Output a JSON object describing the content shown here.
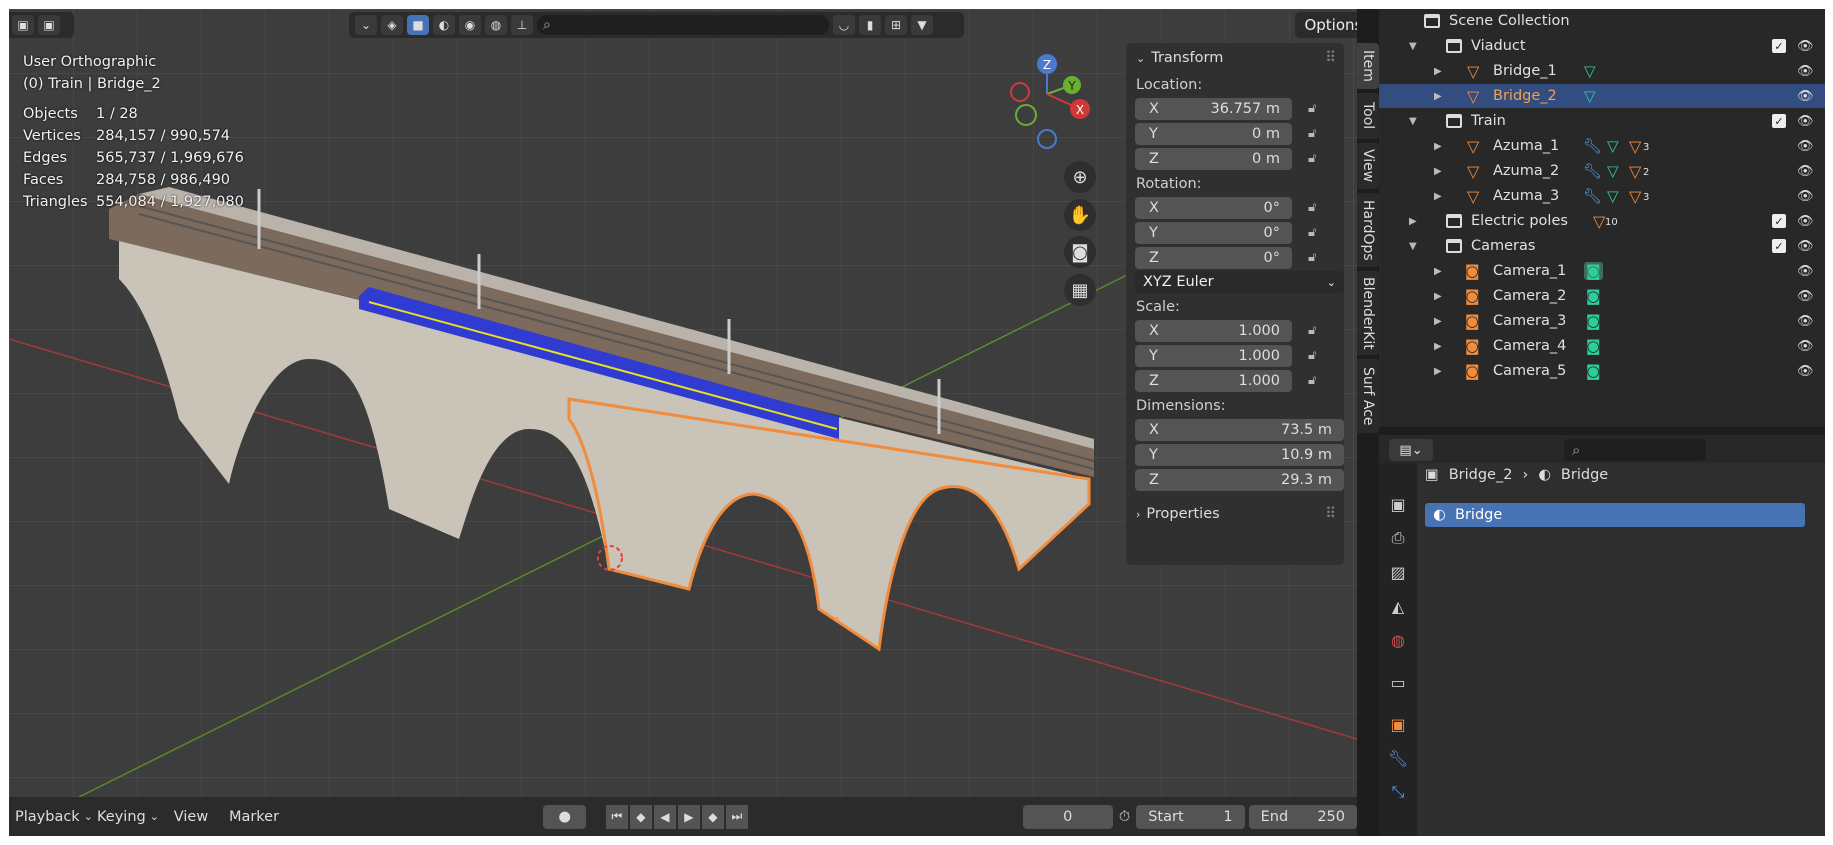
{
  "viewport": {
    "view_name": "User Orthographic",
    "context": "(0) Train | Bridge_2",
    "stats": [
      {
        "key": "Objects",
        "value": "1 / 28"
      },
      {
        "key": "Vertices",
        "value": "284,157 / 990,574"
      },
      {
        "key": "Edges",
        "value": "565,737 / 1,969,676"
      },
      {
        "key": "Faces",
        "value": "284,758 / 986,490"
      },
      {
        "key": "Triangles",
        "value": "554,084 / 1,927,080"
      }
    ],
    "options_label": "Options",
    "gizmo": {
      "z": "Z",
      "y": "Y",
      "x": "X"
    }
  },
  "npanel": {
    "transform_title": "Transform",
    "location_label": "Location:",
    "location": [
      {
        "axis": "X",
        "value": "36.757 m"
      },
      {
        "axis": "Y",
        "value": "0 m"
      },
      {
        "axis": "Z",
        "value": "0 m"
      }
    ],
    "rotation_label": "Rotation:",
    "rotation": [
      {
        "axis": "X",
        "value": "0°"
      },
      {
        "axis": "Y",
        "value": "0°"
      },
      {
        "axis": "Z",
        "value": "0°"
      }
    ],
    "rotation_mode": "XYZ Euler",
    "scale_label": "Scale:",
    "scale": [
      {
        "axis": "X",
        "value": "1.000"
      },
      {
        "axis": "Y",
        "value": "1.000"
      },
      {
        "axis": "Z",
        "value": "1.000"
      }
    ],
    "dimensions_label": "Dimensions:",
    "dimensions": [
      {
        "axis": "X",
        "value": "73.5 m"
      },
      {
        "axis": "Y",
        "value": "10.9 m"
      },
      {
        "axis": "Z",
        "value": "29.3 m"
      }
    ],
    "properties_title": "Properties",
    "tabs": [
      "Item",
      "Tool",
      "View",
      "HardOps",
      "BlenderKit",
      "Surf Ace"
    ]
  },
  "timeline": {
    "playback": "Playback",
    "keying": "Keying",
    "view": "View",
    "marker": "Marker",
    "current_frame": "0",
    "start_label": "Start",
    "start_value": "1",
    "end_label": "End",
    "end_value": "250"
  },
  "outliner": {
    "scene_collection": "Scene Collection",
    "viaduct": "Viaduct",
    "bridge_1": "Bridge_1",
    "bridge_2": "Bridge_2",
    "train": "Train",
    "azuma_1": "Azuma_1",
    "azuma_2": "Azuma_2",
    "azuma_3": "Azuma_3",
    "azuma_1_count": "3",
    "azuma_2_count": "2",
    "azuma_3_count": "3",
    "electric_poles": "Electric poles",
    "electric_poles_count": "10",
    "cameras": "Cameras",
    "camera_1": "Camera_1",
    "camera_2": "Camera_2",
    "camera_3": "Camera_3",
    "camera_4": "Camera_4",
    "camera_5": "Camera_5"
  },
  "properties": {
    "object": "Bridge_2",
    "material_breadcrumb": "Bridge",
    "material_slot": "Bridge"
  },
  "colors": {
    "accent": "#4772b3",
    "selection": "#f08c3c",
    "mesh_data": "#2ccf9c"
  }
}
